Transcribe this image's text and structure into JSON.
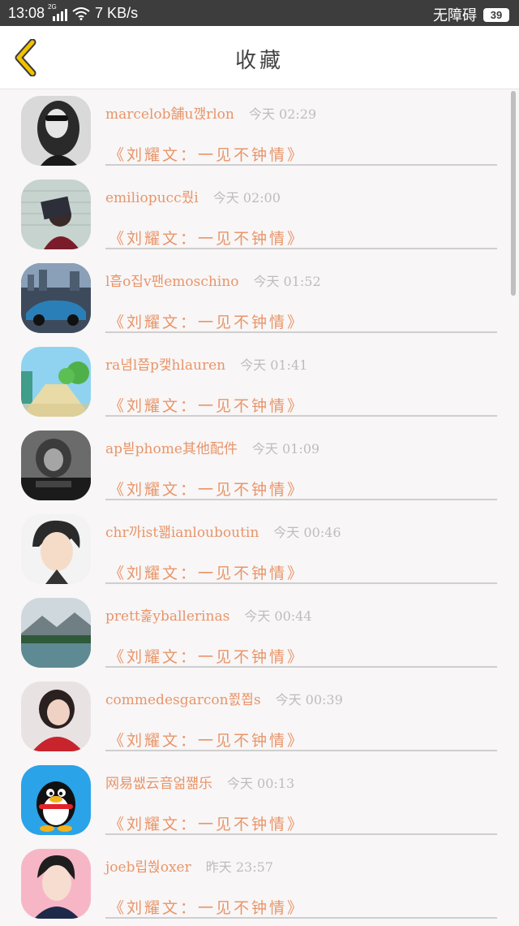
{
  "status_bar": {
    "time": "13:08",
    "network_tag": "2G",
    "speed": "7 KB/s",
    "accessibility": "无障碍",
    "battery": "39"
  },
  "header": {
    "title": "收藏",
    "back_icon": "chevron-left-icon",
    "accent_color": "#f2c200"
  },
  "items": [
    {
      "name": "marcelob舗u깭rlon",
      "time": "今天 02:29",
      "song": "《刘耀文：一见不钟情》",
      "avatar": "woman-portrait-bw"
    },
    {
      "name": "emiliopucc뤘i",
      "time": "今天 02:00",
      "song": "《刘耀文：一见不钟情》",
      "avatar": "person-with-sign"
    },
    {
      "name": "l흡o집v팬emoschino",
      "time": "今天 01:52",
      "song": "《刘耀文：一见不钟情》",
      "avatar": "sports-car"
    },
    {
      "name": "ra념l쯥p캧hlauren",
      "time": "今天 01:41",
      "song": "《刘耀文：一见不钟情》",
      "avatar": "anime-path"
    },
    {
      "name": "ap븯phome其他配件",
      "time": "今天 01:09",
      "song": "《刘耀文：一见不钟情》",
      "avatar": "dark-portrait"
    },
    {
      "name": "chr까ist꽯ianlouboutin",
      "time": "今天 00:46",
      "song": "《刘耀文：一见不钟情》",
      "avatar": "anime-boy"
    },
    {
      "name": "prett훑yballerinas",
      "time": "今天 00:44",
      "song": "《刘耀文：一见不钟情》",
      "avatar": "mountain-lake"
    },
    {
      "name": "commedesgarcon쬜쬡s",
      "time": "今天 00:39",
      "song": "《刘耀文：一见不钟情》",
      "avatar": "girl-red-shirt"
    },
    {
      "name": "网易쌦云音얾쨺乐",
      "time": "今天 00:13",
      "song": "《刘耀文：一见不钟情》",
      "avatar": "qq-penguin"
    },
    {
      "name": "joeb립쒅oxer",
      "time": "昨天 23:57",
      "song": "《刘耀文：一见不钟情》",
      "avatar": "anime-boy-pink"
    }
  ]
}
